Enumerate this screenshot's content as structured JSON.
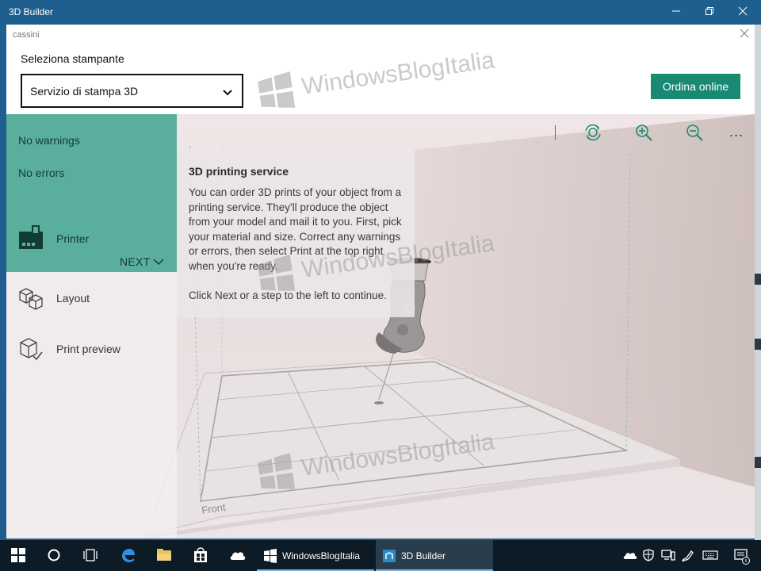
{
  "window": {
    "title": "3D Builder"
  },
  "dialog": {
    "title": "cassini",
    "printer_label": "Seleziona stampante",
    "printer_value": "Servizio di stampa 3D",
    "order_button": "Ordina online"
  },
  "status": {
    "warnings": "No warnings",
    "errors": "No errors"
  },
  "steps": {
    "printer": "Printer",
    "next": "NEXT",
    "layout": "Layout",
    "preview": "Print preview"
  },
  "info": {
    "heading": "3D printing service",
    "body": "You can order 3D prints of your object from a printing service. They'll produce the object from your model and mail it to you. First, pick your material and size. Correct any warnings or errors, then select Print  at the top right when you're ready.",
    "continue": "Click Next or a step to the left to continue."
  },
  "toolbar": {
    "icons": [
      "rotate-view-icon",
      "zoom-in-icon",
      "zoom-out-icon",
      "more-icon"
    ],
    "more": "..."
  },
  "scene": {
    "front_label": "Front"
  },
  "watermark": "WindowsBlogItalia",
  "taskbar": {
    "apps": [
      {
        "label": "WindowsBlogItalia"
      },
      {
        "label": "3D Builder"
      }
    ]
  },
  "colors": {
    "titlebar": "#1f5f8f",
    "accent": "#188a73",
    "status_panel": "#5aae9e",
    "taskbar": "#0c1b26"
  }
}
